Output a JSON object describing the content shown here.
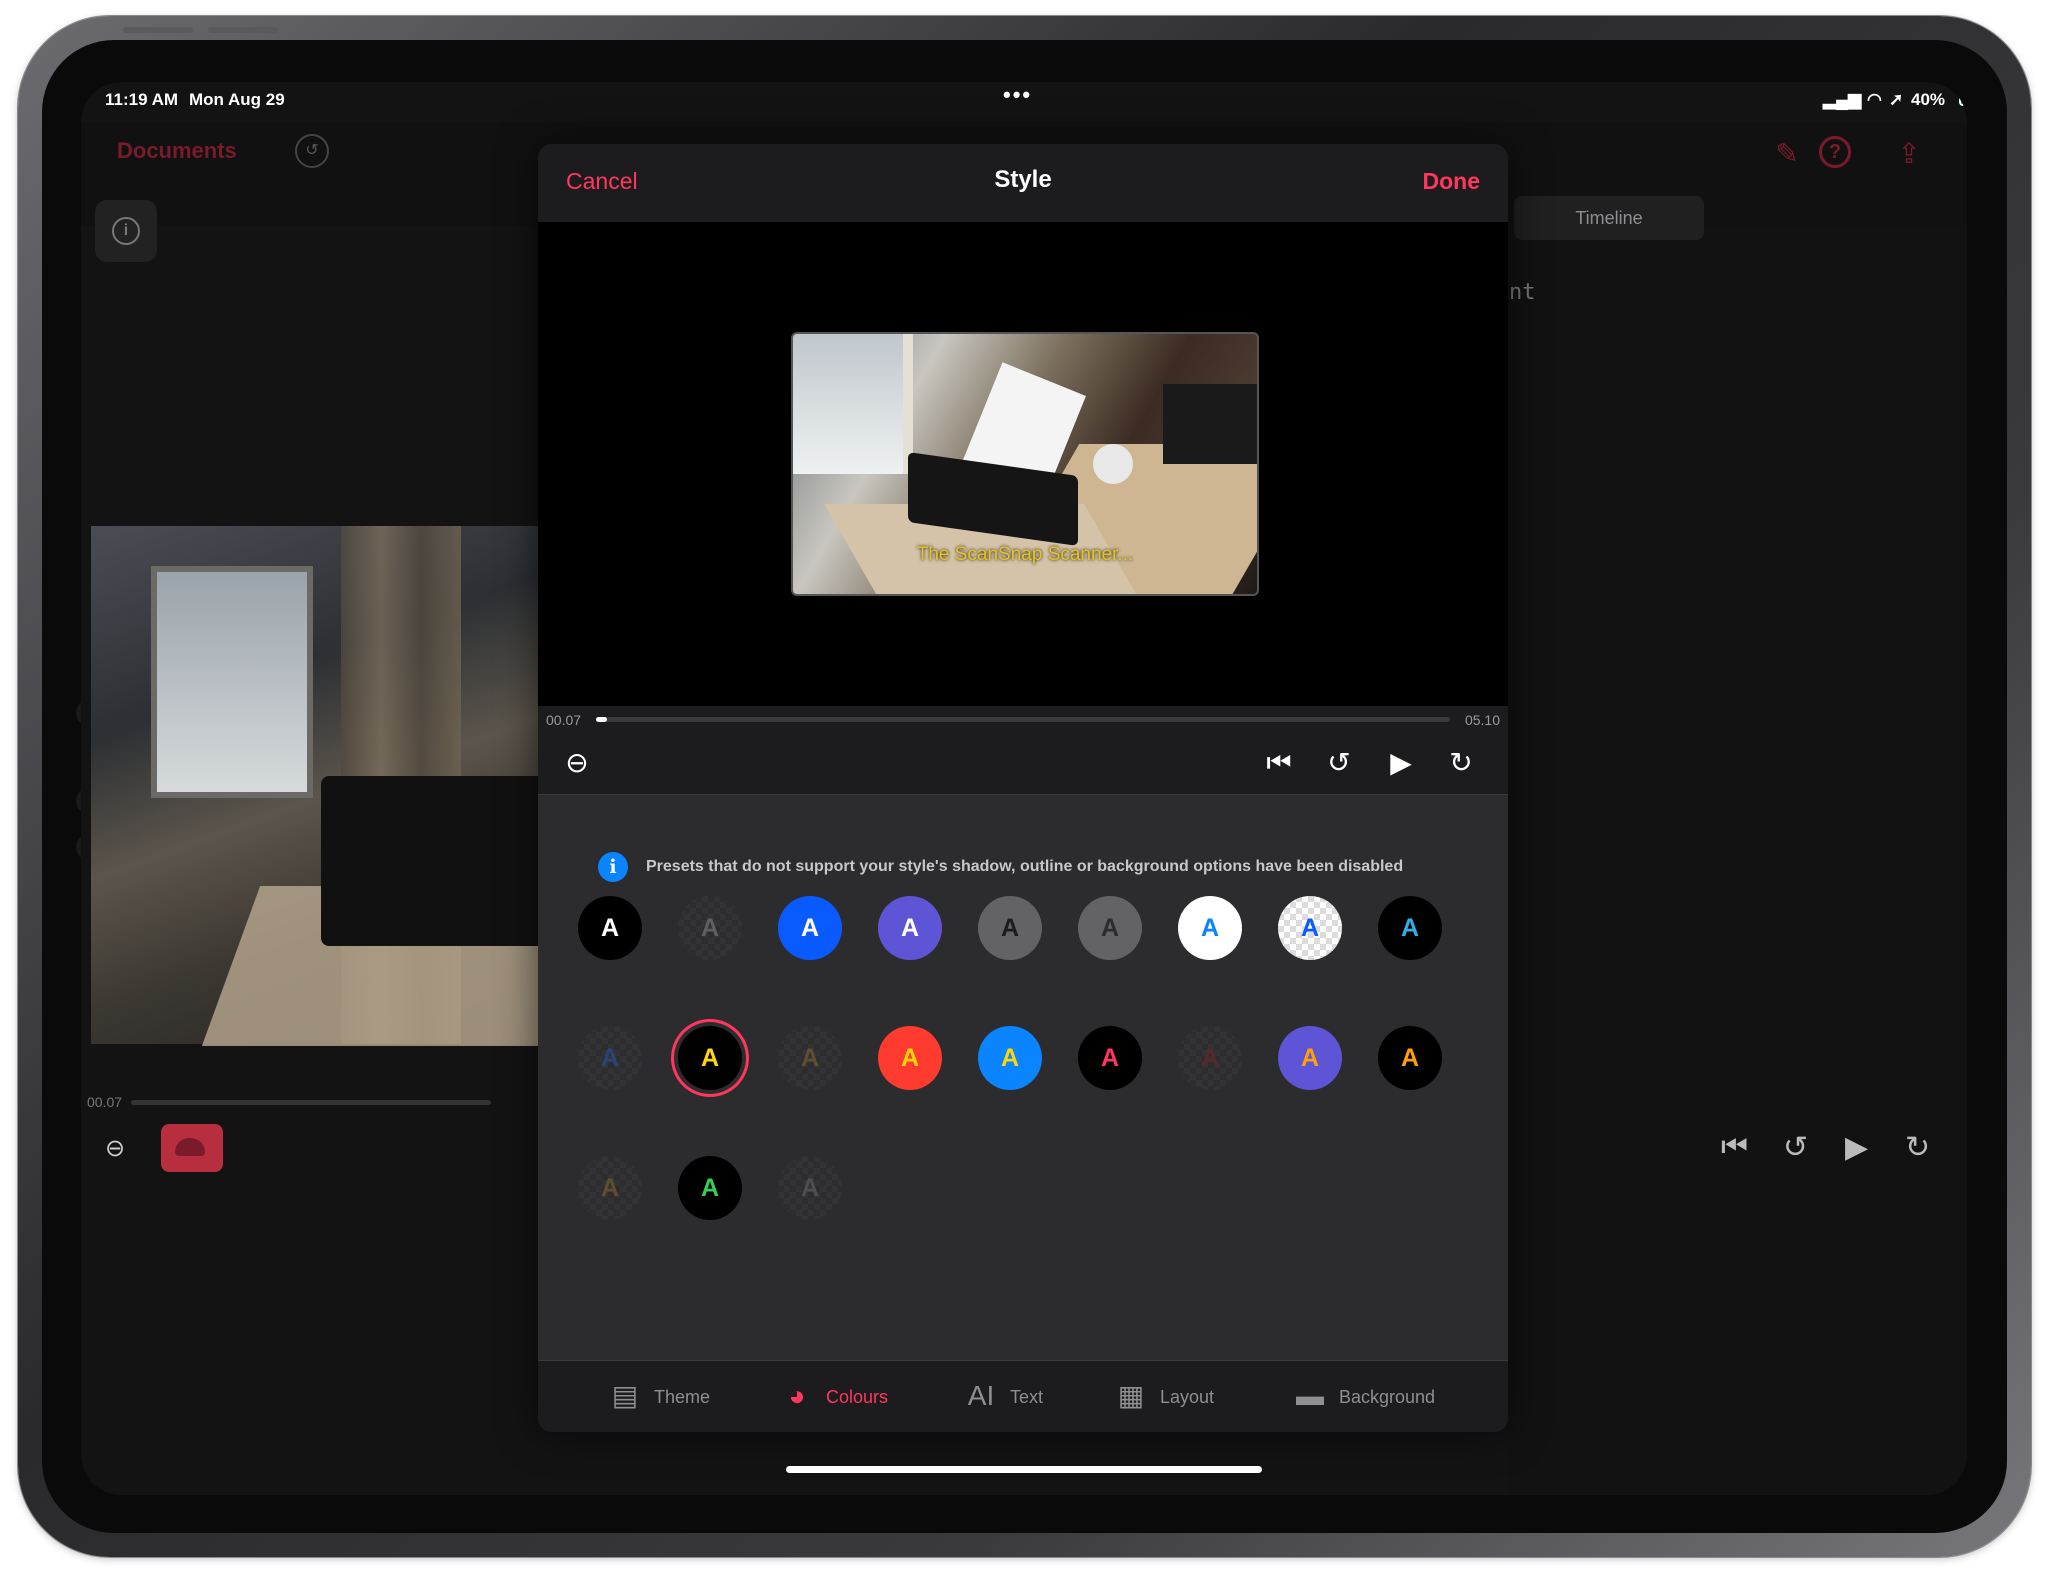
{
  "status_bar": {
    "time": "11:19 AM",
    "date": "Mon Aug 29",
    "battery": "40%"
  },
  "background_app": {
    "documents_label": "Documents",
    "timeline_tab": "Timeline",
    "partial_text": "nt",
    "current_time": "00.07"
  },
  "modal": {
    "cancel": "Cancel",
    "title": "Style",
    "done": "Done",
    "caption": "The ScanSnap Scanner...",
    "time_current": "00.07",
    "time_total": "05.10",
    "progress": 0.013,
    "notice": "Presets that do not support your style's shadow, outline or background options have been disabled",
    "accent": "#ff375f"
  },
  "presets": [
    {
      "bg": "#000000",
      "fg": "#ffffff",
      "style": "solid"
    },
    {
      "bg": "checker",
      "fg": "#8a8a8e",
      "style": "dim"
    },
    {
      "bg": "#0a5bff",
      "fg": "#ffffff",
      "style": "solid"
    },
    {
      "bg": "#5e55d6",
      "fg": "#ffffff",
      "style": "solid"
    },
    {
      "bg": "#636366",
      "fg": "#1c1c1e",
      "style": "solid"
    },
    {
      "bg": "#636366",
      "fg": "#2c2c2e",
      "style": "checker-soft"
    },
    {
      "bg": "#ffffff",
      "fg": "#0a84ff",
      "style": "solid"
    },
    {
      "bg": "checker-light",
      "fg": "#0a5bff",
      "style": "solid"
    },
    {
      "bg": "#000000",
      "fg": "#32ade6",
      "style": "solid"
    },
    {
      "bg": "checker",
      "fg": "#2a5bb0",
      "style": "dim"
    },
    {
      "bg": "#000000",
      "fg": "#ffd60a",
      "style": "selected"
    },
    {
      "bg": "checker",
      "fg": "#8a6a30",
      "style": "dim"
    },
    {
      "bg": "#ff3b30",
      "fg": "#ffd60a",
      "style": "solid"
    },
    {
      "bg": "#0a84ff",
      "fg": "#ffd60a",
      "style": "solid"
    },
    {
      "bg": "#000000",
      "fg": "#ff375f",
      "style": "solid"
    },
    {
      "bg": "checker",
      "fg": "#7a2a2a",
      "style": "dim"
    },
    {
      "bg": "#5e55d6",
      "fg": "#ff9f0a",
      "style": "solid"
    },
    {
      "bg": "#000000",
      "fg": "#ff9f0a",
      "style": "solid"
    },
    {
      "bg": "checker",
      "fg": "#8a6a30",
      "style": "dim"
    },
    {
      "bg": "#000000",
      "fg": "#30d158",
      "style": "solid"
    },
    {
      "bg": "checker",
      "fg": "#6a6a6e",
      "style": "dim"
    }
  ],
  "preset_letter": "A",
  "tabs": [
    {
      "label": "Theme",
      "icon": "theme-icon",
      "active": false
    },
    {
      "label": "Colours",
      "icon": "palette-icon",
      "active": true
    },
    {
      "label": "Text",
      "icon": "text-icon",
      "active": false
    },
    {
      "label": "Layout",
      "icon": "grid-icon",
      "active": false
    },
    {
      "label": "Background",
      "icon": "background-icon",
      "active": false
    }
  ]
}
